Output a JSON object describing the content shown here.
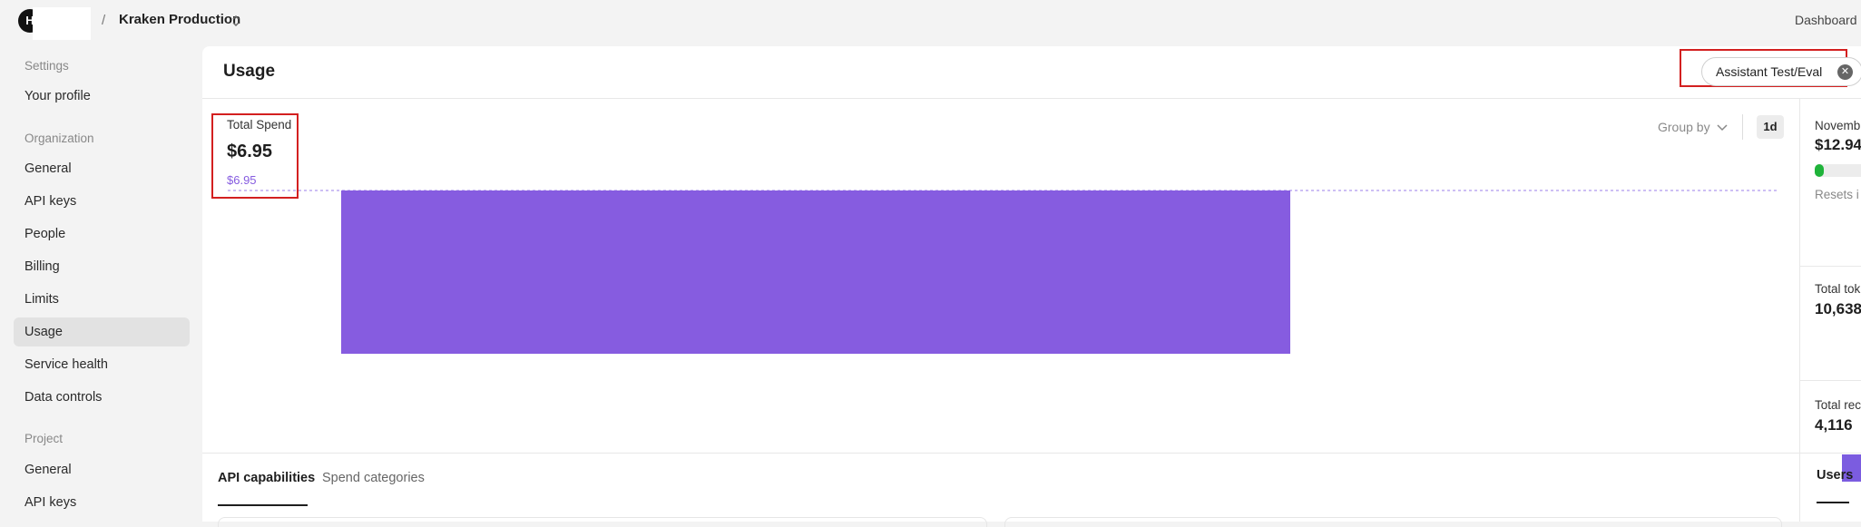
{
  "topbar": {
    "logo_letter": "H",
    "separator": "/",
    "org_name": "Kraken Production",
    "dashboard_link": "Dashboard"
  },
  "sidebar": {
    "settings_heading": "Settings",
    "your_profile": "Your profile",
    "organization_heading": "Organization",
    "org_items": [
      "General",
      "API keys",
      "People",
      "Billing",
      "Limits",
      "Usage",
      "Service health",
      "Data controls"
    ],
    "active_item": "Usage",
    "project_heading": "Project",
    "project_items": [
      "General",
      "API keys"
    ]
  },
  "main": {
    "title": "Usage",
    "filter_label": "Assistant Test/Eval",
    "filter_remove": "✕"
  },
  "chart": {
    "spend_label": "Total Spend",
    "spend_value": "$6.95",
    "group_by_label": "Group by",
    "range_label": "1d"
  },
  "chart_data": {
    "type": "bar",
    "categories": [
      ""
    ],
    "values": [
      6.95
    ],
    "reference_line": {
      "value": 6.95,
      "label": "$6.95"
    },
    "ylim": [
      0,
      6.95
    ],
    "bar_color": "#865ce0",
    "grid": false
  },
  "tabs": [
    "API capabilities",
    "Spend categories"
  ],
  "active_tab": "API capabilities",
  "right_panel": {
    "budget_label": "Novemb",
    "budget_value": "$12.94",
    "budget_progress": 0.02,
    "resets_text": "Resets i",
    "tokens_label": "Total tok",
    "tokens_value": "10,638",
    "requests_label": "Total rec",
    "requests_value": "4,116",
    "users_tab": "Users"
  },
  "colors": {
    "accent": "#865ce0",
    "highlight_box": "#d32020",
    "progress_green": "#1fb33a"
  }
}
